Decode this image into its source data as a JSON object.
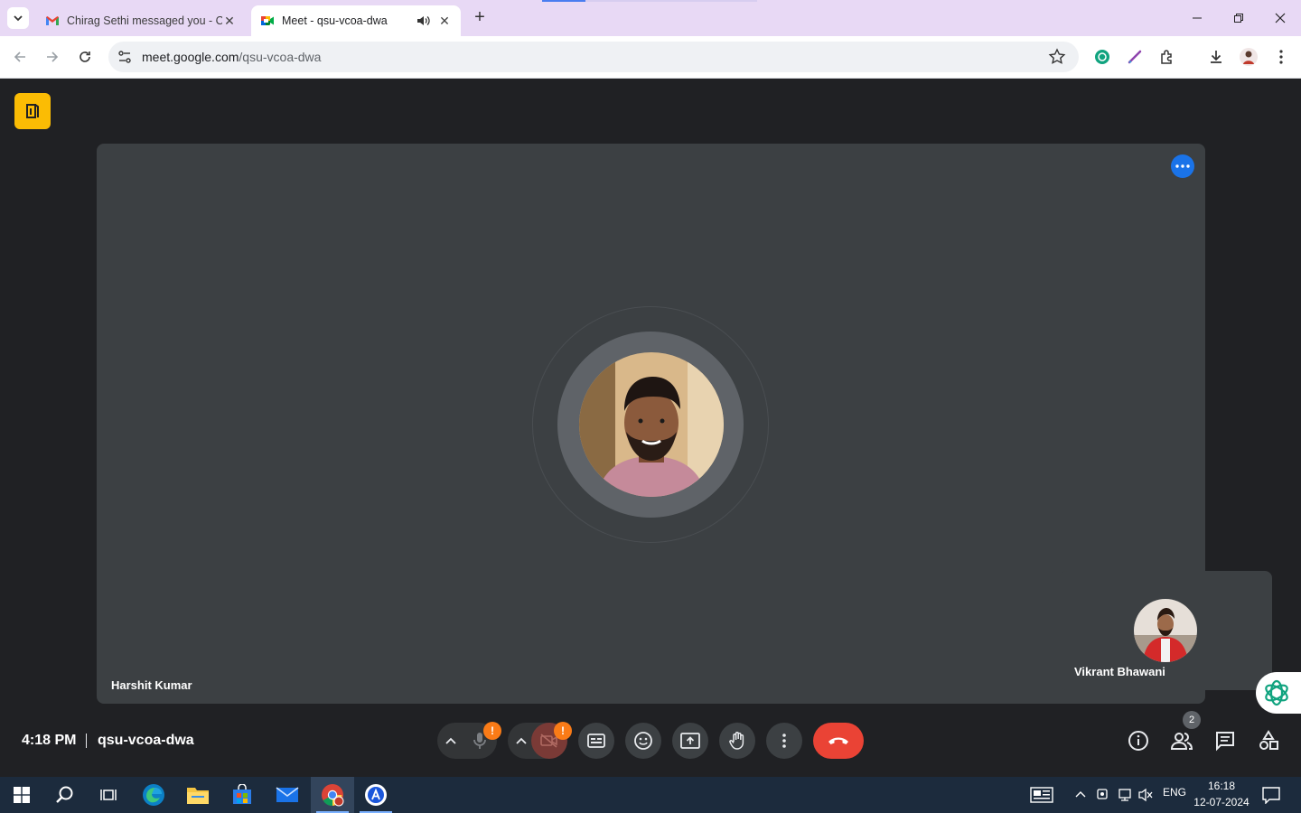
{
  "browser": {
    "tabs": [
      {
        "title": "Chirag Sethi messaged you - Ch",
        "active": false,
        "favicon": "gmail-icon"
      },
      {
        "title": "Meet - qsu-vcoa-dwa",
        "active": true,
        "favicon": "meet-icon",
        "audio": true
      }
    ],
    "url_host": "meet.google.com",
    "url_path": "/qsu-vcoa-dwa"
  },
  "meet": {
    "main_participant": "Harshit Kumar",
    "self_participant": "Vikrant Bhawani",
    "time": "4:18 PM",
    "meeting_code": "qsu-vcoa-dwa",
    "participant_count": "2",
    "mic_warning": "!",
    "cam_warning": "!",
    "colors": {
      "end_call": "#ea4335",
      "warning": "#fa7b17",
      "accent": "#1a73e8",
      "logo": "#fbbc04"
    }
  },
  "taskbar": {
    "language": "ENG",
    "time": "16:18",
    "date": "12-07-2024"
  }
}
